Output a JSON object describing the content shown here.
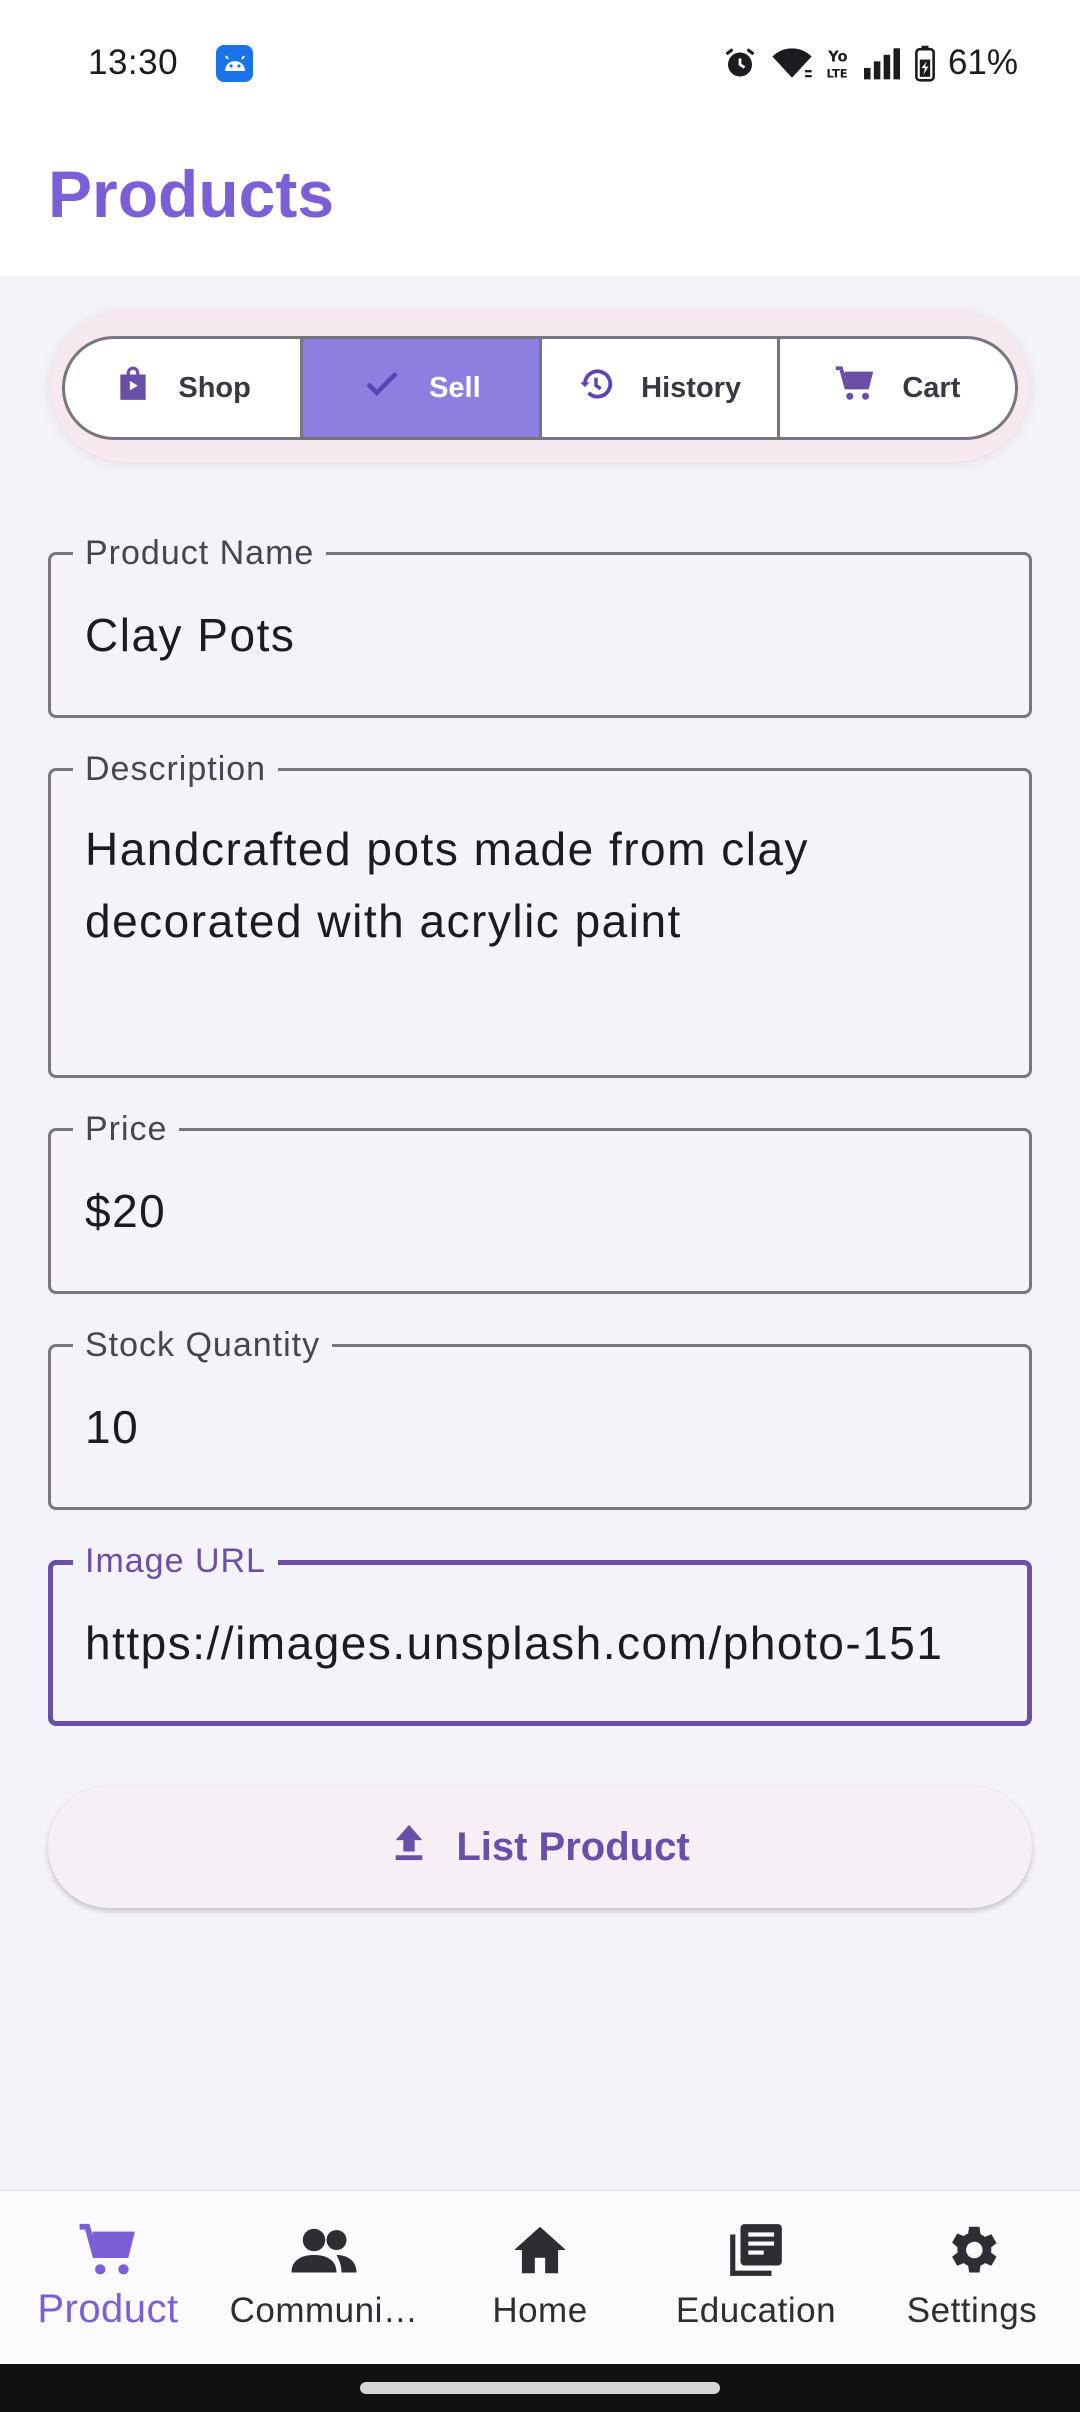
{
  "status_bar": {
    "time": "13:30",
    "battery": "61%",
    "icons": [
      "android-app-icon",
      "alarm-icon",
      "wifi-icon",
      "volte-icon",
      "signal-icon",
      "battery-icon"
    ]
  },
  "header": {
    "title": "Products"
  },
  "segments": [
    {
      "label": "Shop",
      "icon": "shopping-bag-icon",
      "selected": false
    },
    {
      "label": "Sell",
      "icon": "check-icon",
      "selected": true
    },
    {
      "label": "History",
      "icon": "history-icon",
      "selected": false
    },
    {
      "label": "Cart",
      "icon": "cart-icon",
      "selected": false
    }
  ],
  "form": {
    "product_name": {
      "label": "Product Name",
      "value": "Clay Pots"
    },
    "description": {
      "label": "Description",
      "value": "Handcrafted pots made from clay decorated with acrylic paint"
    },
    "price": {
      "label": "Price",
      "value": "$20"
    },
    "stock_quantity": {
      "label": "Stock Quantity",
      "value": "10"
    },
    "image_url": {
      "label": "Image URL",
      "value": "https://images.unsplash.com/photo-151"
    },
    "submit_label": "List Product"
  },
  "bottom_nav": [
    {
      "label": "Product",
      "icon": "cart-icon",
      "active": true
    },
    {
      "label": "Communi…",
      "icon": "people-icon",
      "active": false
    },
    {
      "label": "Home",
      "icon": "home-icon",
      "active": false
    },
    {
      "label": "Education",
      "icon": "library-books-icon",
      "active": false
    },
    {
      "label": "Settings",
      "icon": "gear-icon",
      "active": false
    }
  ],
  "colors": {
    "accent": "#7b5fd6",
    "selected_segment": "#8d7fe0",
    "focused_outline": "#6a4fa8",
    "background": "#f3f3f9"
  }
}
